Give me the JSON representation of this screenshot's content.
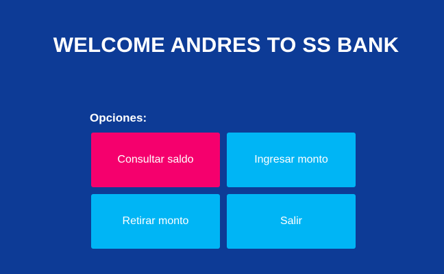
{
  "header": {
    "title": "WELCOME ANDRES TO SS BANK"
  },
  "menu": {
    "label": "Opciones:",
    "buttons": [
      {
        "label": "Consultar saldo",
        "color": "#f5006d",
        "active": true
      },
      {
        "label": "Ingresar monto",
        "color": "#00b5f5",
        "active": false
      },
      {
        "label": "Retirar monto",
        "color": "#00b5f5",
        "active": false
      },
      {
        "label": "Salir",
        "color": "#00b5f5",
        "active": false
      }
    ]
  },
  "theme": {
    "background": "#0d3b96",
    "text": "#ffffff"
  }
}
